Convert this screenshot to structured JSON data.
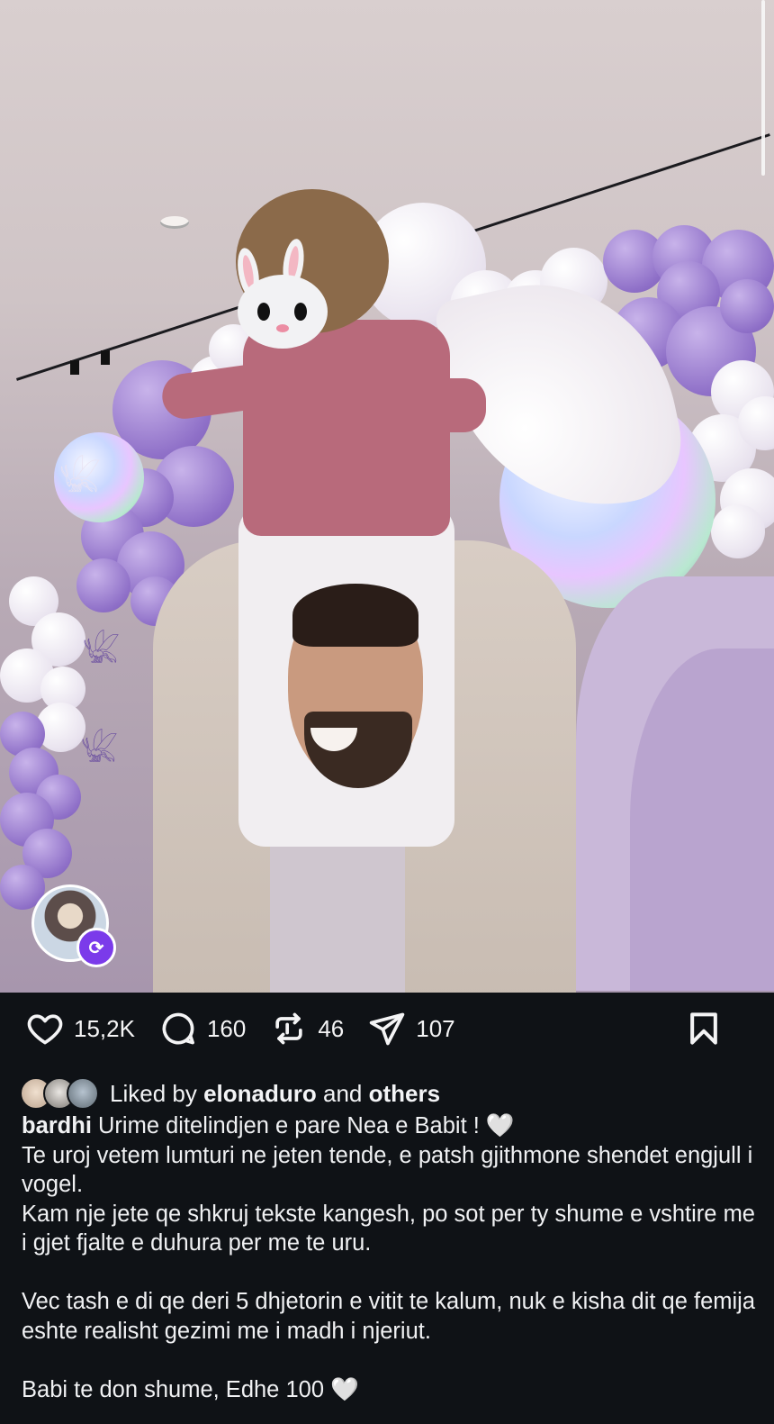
{
  "post": {
    "likes": "15,2K",
    "comments": "160",
    "reposts": "46",
    "shares": "107"
  },
  "liked_by": {
    "prefix": "Liked by",
    "user": "elonaduro",
    "middle": "and",
    "others": "others"
  },
  "caption": {
    "author": "bardhi",
    "line1": "Urime ditelindjen e pare Nea e Babit ! 🤍",
    "body": "Te uroj vetem lumturi ne jeten tende, e patsh gjithmone shendet engjull i vogel.\nKam nje jete qe shkruj tekste kangesh, po sot per ty shume e vshtire me i gjet fjalte e duhura per me te uru.\n\nVec tash e di qe deri 5 dhjetorin e vitit te kalum, nuk e kisha dit qe femija eshte realisht gezimi me i madh i njeriut.\n\nBabi te don shume, Edhe 100 🤍"
  },
  "icons": {
    "like": "heart-icon",
    "comment": "comment-icon",
    "repost": "repost-icon",
    "share": "share-icon",
    "bookmark": "bookmark-icon"
  },
  "colors": {
    "background": "#0f1216",
    "text": "#f0f1f3",
    "repost_badge": "#7b3bea"
  }
}
